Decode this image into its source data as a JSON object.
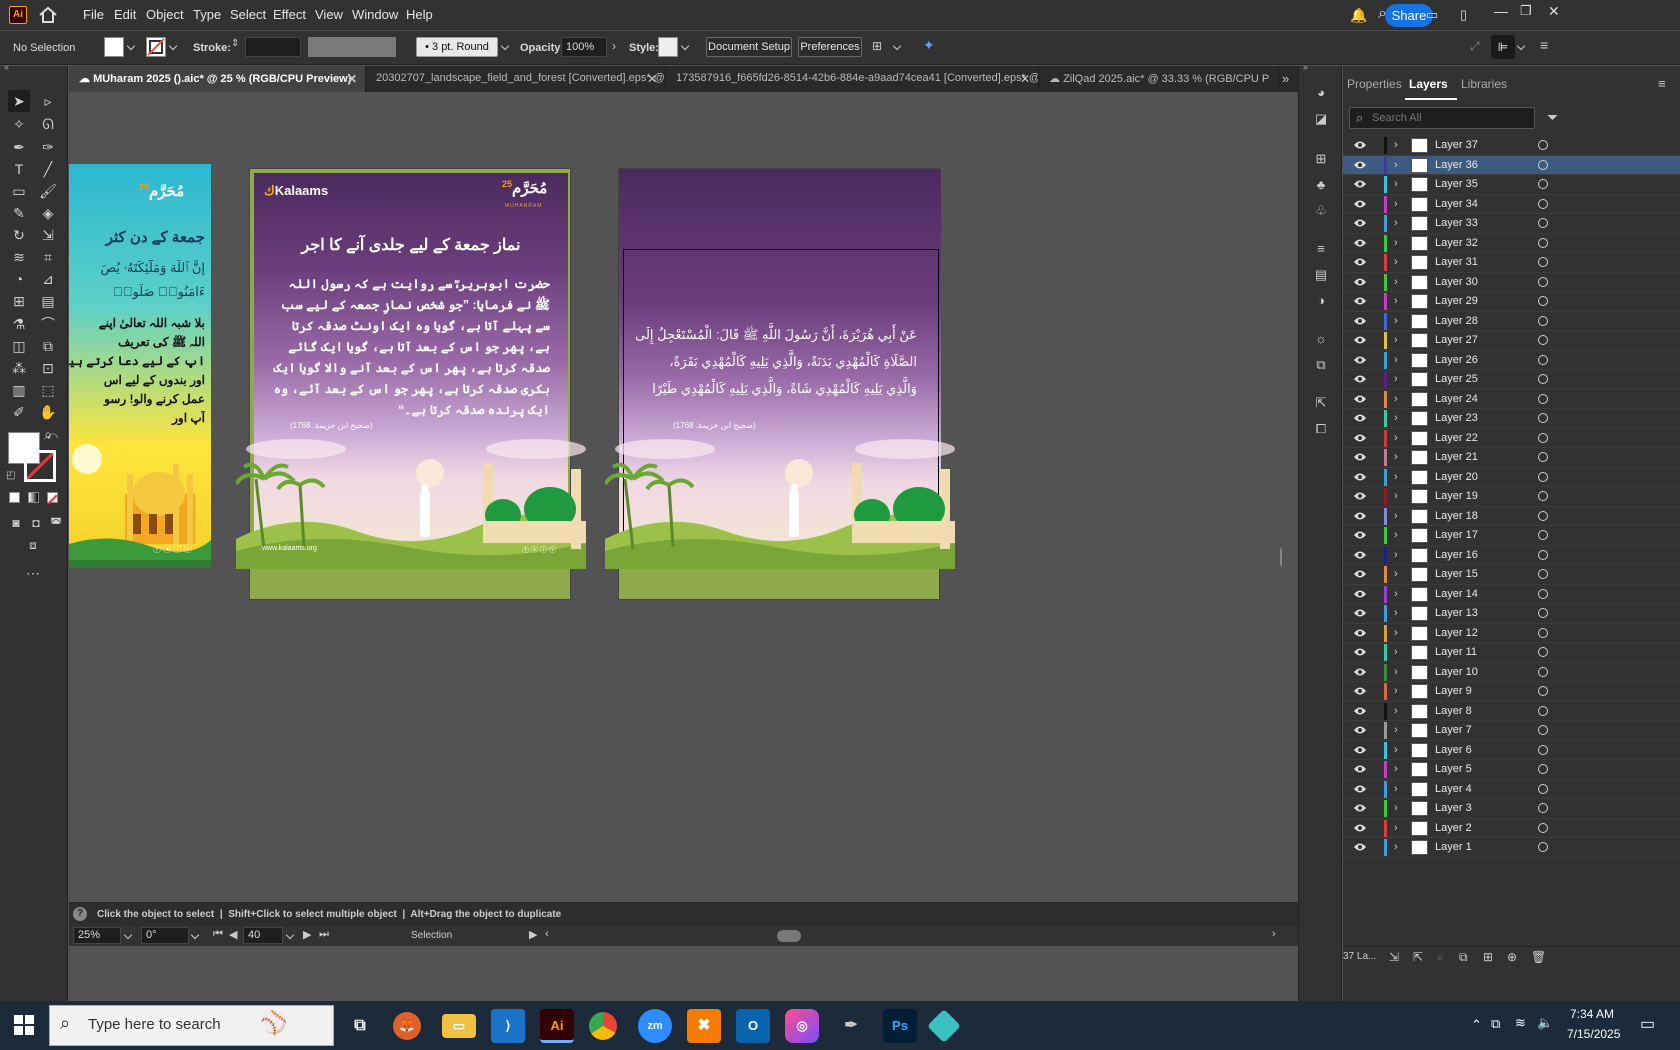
{
  "app": {
    "logo": "Ai"
  },
  "menu": [
    "File",
    "Edit",
    "Object",
    "Type",
    "Select",
    "Effect",
    "View",
    "Window",
    "Help"
  ],
  "share_label": "Share",
  "control": {
    "selection": "No Selection",
    "stroke_label": "Stroke:",
    "brush": "3 pt. Round",
    "opacity_label": "Opacity:",
    "opacity_value": "100%",
    "style_label": "Style:",
    "doc_setup": "Document Setup",
    "preferences": "Preferences"
  },
  "tabs": [
    {
      "label": "MUharam 2025 ().aic* @ 25 % (RGB/CPU Preview)"
    },
    {
      "label": "20302707_landscape_field_and_forest [Converted].eps* @ 12.5 % (RGB/CPU"
    },
    {
      "label": "173587916_f665fd26-8514-42b6-884e-a9aad74cea41 [Converted].eps* @ 50"
    },
    {
      "label": "ZilQad 2025.aic* @ 33.33 % (RGB/CPU P"
    }
  ],
  "artboard1": {
    "brand": "Kalaams",
    "logo_text": "مُحَرَّم",
    "logo_num": "25",
    "logo_sub": "MUHARRAM",
    "title": "نماز جمعة کے لیے جلدی آنے کا اجر",
    "body": "حضرت ابوہریرہؓ سے روایت ہے کہ رسول اللہ ﷺ نے فرمایا: ”جو شخص نمازِ جمعہ کے لیے سب سے پہلے آتا ہے، گویا وہ ایک اونٹ صدقہ کرتا ہے، پھر جو اس کے بعد آتا ہے، گویا ایک گائے صدقہ کرتا ہے، پھر اس کے بعد آنے والا گویا ایک بکری صدقہ کرتا ہے، پھر جو اس کے بعد آئے، وہ ایک پرندہ صدقہ کرتا ہے۔“",
    "reference": "(صحیح ابن خزیمة: 1768)",
    "website": "www.kalaams.org"
  },
  "artboard2": {
    "body": "عَنْ أَبِي هُرَيْرَةَ، أَنَّ رَسُولَ اللَّهِ ﷺ قَالَ: الْمُسْتَعْجِلُ إِلَى الصَّلَاةِ كَالْمُهْدِي بَدَنَةً، وَالَّذِي يَلِيهِ كَالْمُهْدِي بَقَرَةً، وَالَّذِي يَلِيهِ كَالْمُهْدِي شَاةً، وَالَّذِي يَلِيهِ كَالْمُهْدِي طَيْرًا",
    "reference": "(صحیح ابن خزیمة: 1768)"
  },
  "artboard0": {
    "logo_text": "مُحَرَّم",
    "logo_num": "25",
    "heading": "جمعة کے دن کثر",
    "verse1": "إِنَّ ٱللَّهَ وَمَلَٰٓئِكَتَهُۥ يُصَ",
    "verse2": "ءَامَنُوا۟ صَلُّوا۟",
    "l1": "بلا شبہ اللہ تعالیٰ اپنے",
    "l2": "اللہ ﷺ کی تعریف",
    "l3": "اپ کے لیے دعا کرتے ہیں",
    "l4": "اور بندوں کے لیے اس",
    "l5": "عمل کرنے والو! رسو",
    "l6": "آپ اور"
  },
  "panel": {
    "tabs": [
      "Properties",
      "Layers",
      "Libraries"
    ],
    "search_placeholder": "Search All"
  },
  "layers": [
    {
      "name": "Layer 37",
      "color": "#111111"
    },
    {
      "name": "Layer 36",
      "color": "#3c3c9a",
      "selected": true
    },
    {
      "name": "Layer 35",
      "color": "#3ec1e6"
    },
    {
      "name": "Layer 34",
      "color": "#c23ec7"
    },
    {
      "name": "Layer 33",
      "color": "#3e9ed9"
    },
    {
      "name": "Layer 32",
      "color": "#3ec73e"
    },
    {
      "name": "Layer 31",
      "color": "#d93e3e"
    },
    {
      "name": "Layer 30",
      "color": "#3ec73e"
    },
    {
      "name": "Layer 29",
      "color": "#c23ec7"
    },
    {
      "name": "Layer 28",
      "color": "#3e6ad9"
    },
    {
      "name": "Layer 27",
      "color": "#d9c43e"
    },
    {
      "name": "Layer 26",
      "color": "#3e9ed9"
    },
    {
      "name": "Layer 25",
      "color": "#5a1e8a"
    },
    {
      "name": "Layer 24",
      "color": "#d98a3e"
    },
    {
      "name": "Layer 23",
      "color": "#3ec7a0"
    },
    {
      "name": "Layer 22",
      "color": "#c23e3e"
    },
    {
      "name": "Layer 21",
      "color": "#c27a9a"
    },
    {
      "name": "Layer 20",
      "color": "#3e9ed9"
    },
    {
      "name": "Layer 19",
      "color": "#8a1e1e"
    },
    {
      "name": "Layer 18",
      "color": "#8a8ad9"
    },
    {
      "name": "Layer 17",
      "color": "#3ec73e"
    },
    {
      "name": "Layer 16",
      "color": "#1e1e8a"
    },
    {
      "name": "Layer 15",
      "color": "#d98a3e"
    },
    {
      "name": "Layer 14",
      "color": "#9a3ed9"
    },
    {
      "name": "Layer 13",
      "color": "#3e9ed9"
    },
    {
      "name": "Layer 12",
      "color": "#d9a03e"
    },
    {
      "name": "Layer 11",
      "color": "#3ec7a0"
    },
    {
      "name": "Layer 10",
      "color": "#3e8a3e"
    },
    {
      "name": "Layer 9",
      "color": "#d96a3e"
    },
    {
      "name": "Layer 8",
      "color": "#111111"
    },
    {
      "name": "Layer 7",
      "color": "#9a9a9a"
    },
    {
      "name": "Layer 6",
      "color": "#3ec1e6"
    },
    {
      "name": "Layer 5",
      "color": "#c23ec7"
    },
    {
      "name": "Layer 4",
      "color": "#3e9ed9"
    },
    {
      "name": "Layer 3",
      "color": "#3ec73e"
    },
    {
      "name": "Layer 2",
      "color": "#d93e3e"
    },
    {
      "name": "Layer 1",
      "color": "#3e9ed9"
    }
  ],
  "layers_count": "37 La...",
  "status": {
    "hint1": "Click the object to select",
    "hint2": "Shift+Click to select multiple object",
    "hint3": "Alt+Drag the object to duplicate",
    "zoom": "25%",
    "angle": "0°",
    "page": "40",
    "mode": "Selection"
  },
  "taskbar": {
    "search_placeholder": "Type here to search",
    "time": "7:34 AM",
    "date": "7/15/2025"
  }
}
